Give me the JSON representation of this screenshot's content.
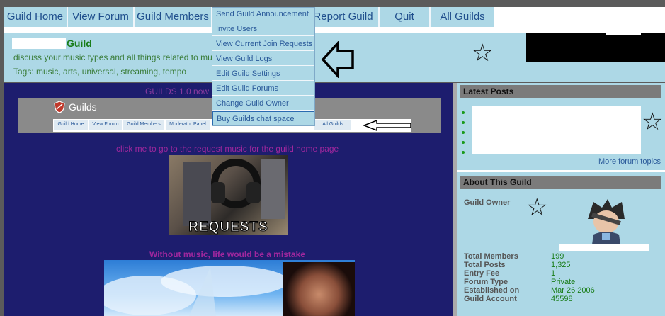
{
  "nav": {
    "tabs": [
      "Guild Home",
      "View Forum",
      "Guild Members",
      "Report Guild",
      "Quit",
      "All Guilds"
    ]
  },
  "dropdown": {
    "items": [
      "Send Guild Announcement",
      "Invite Users",
      "View Current Join Requests",
      "View Guild Logs",
      "Edit Guild Settings",
      "Edit Guild Forums",
      "Change Guild Owner",
      "Buy Guilds chat space"
    ]
  },
  "header": {
    "title": "Guild",
    "description": "discuss your music types and all things related to mu",
    "tags": "Tags: music, arts, universal, streaming, tempo"
  },
  "main": {
    "notice": "GUILDS 1.0 now",
    "banner_label": "Guilds",
    "mini_nav": [
      "Guild Home",
      "View Forum",
      "Guild Members",
      "Moderator Panel",
      "All Guilds"
    ],
    "request_caption": "click me to go to the request music for the guild home page",
    "request_image_text": "REQUESTS",
    "quote": "Without music, life would be a mistake"
  },
  "latest_posts": {
    "heading": "Latest Posts",
    "more_link": "More forum topics"
  },
  "about": {
    "heading": "About This Guild",
    "owner_label": "Guild Owner",
    "stats": [
      {
        "label": "Total Members",
        "value": "199"
      },
      {
        "label": "Total Posts",
        "value": "1,325"
      },
      {
        "label": "Entry Fee",
        "value": "1"
      },
      {
        "label": "Forum Type",
        "value": "Private"
      },
      {
        "label": "Established on",
        "value": "Mar 26 2006"
      },
      {
        "label": "Guild Account",
        "value": "45598"
      }
    ]
  },
  "icons": {
    "star": "star-outline-icon",
    "arrow": "arrow-left-icon"
  }
}
